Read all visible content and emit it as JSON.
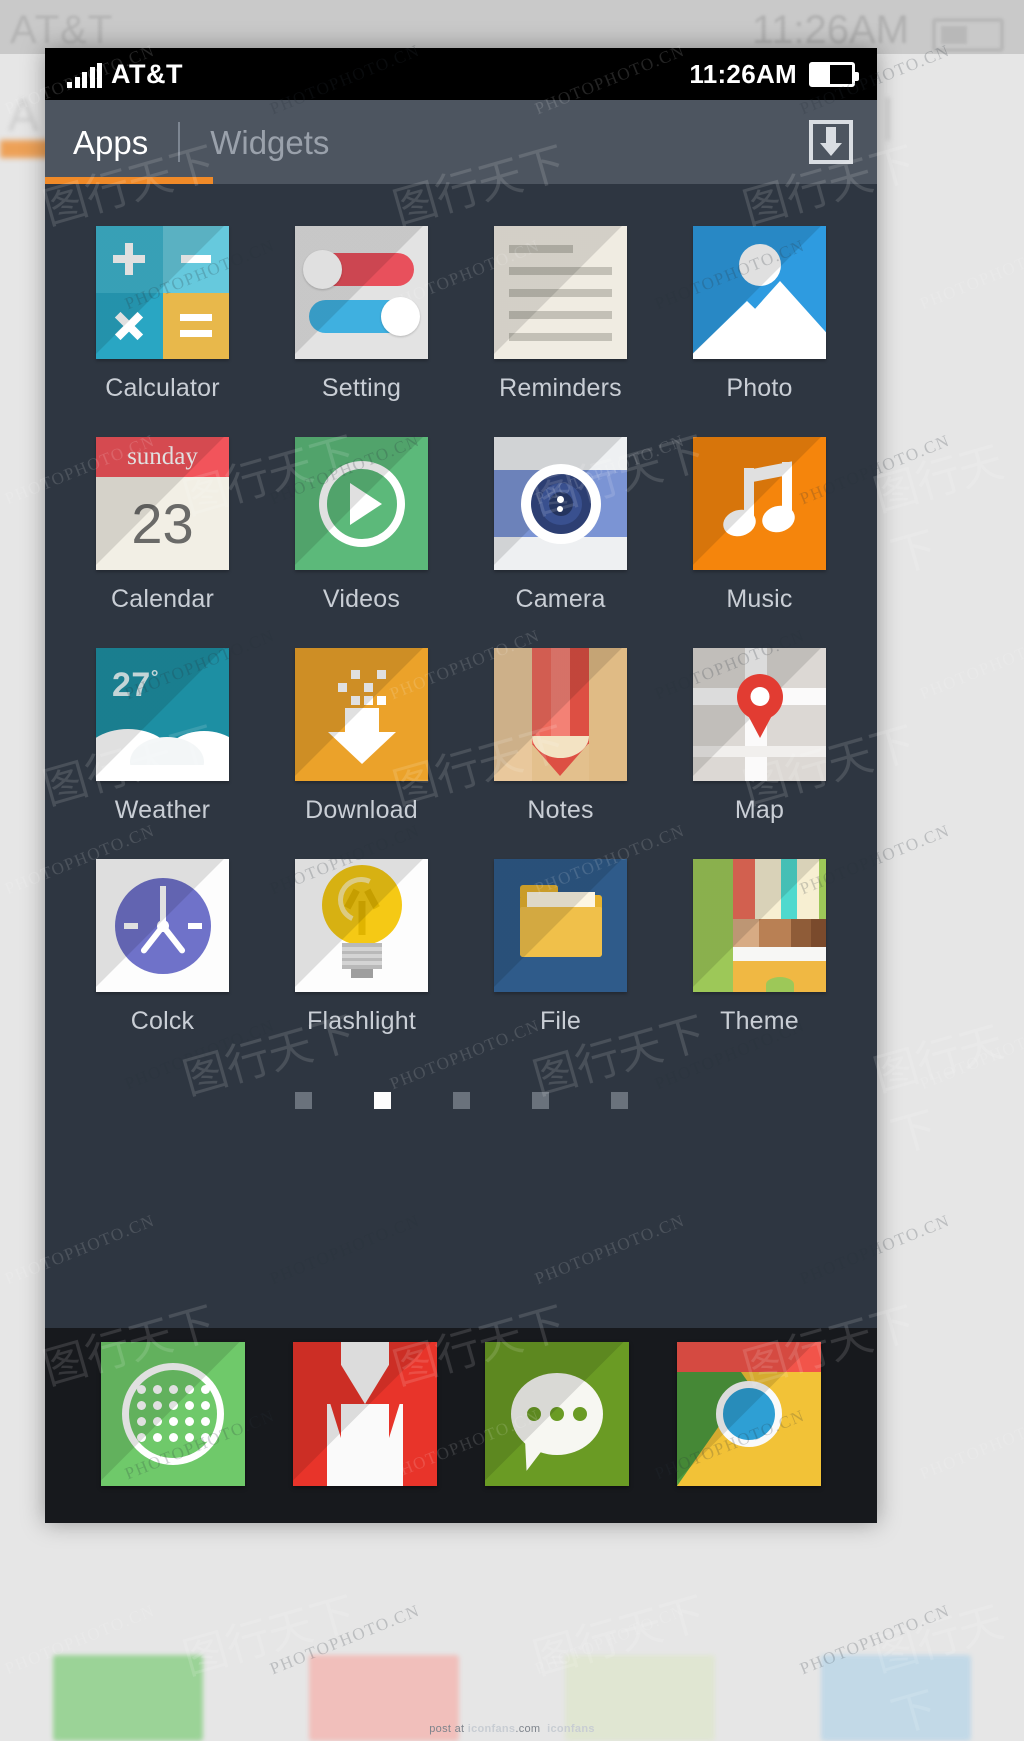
{
  "statusbar": {
    "carrier": "AT&T",
    "time": "11:26AM",
    "signal_icon": "signal-bars-icon",
    "battery_icon": "battery-icon"
  },
  "tabbar": {
    "tabs": [
      {
        "label": "Apps",
        "active": true
      },
      {
        "label": "Widgets",
        "active": false
      }
    ],
    "download_icon": "download-tray-icon",
    "accent_color": "#f08a28"
  },
  "apps": [
    {
      "label": "Calculator",
      "icon": "calculator-icon",
      "keys": [
        "+",
        "−",
        "×",
        "="
      ],
      "colors": [
        "#3fb6cf",
        "#66c9dd",
        "#29a6c3",
        "#e8b84b"
      ]
    },
    {
      "label": "Setting",
      "icon": "settings-toggles-icon",
      "colors": [
        "#e8505c",
        "#3fb0e0",
        "#e3e3e3"
      ]
    },
    {
      "label": "Reminders",
      "icon": "reminders-lines-icon",
      "colors": [
        "#f0ece2",
        "#c3c0b6"
      ]
    },
    {
      "label": "Photo",
      "icon": "photo-mountain-icon",
      "colors": [
        "#2e9be0",
        "#ffffff"
      ]
    },
    {
      "label": "Calendar",
      "icon": "calendar-icon",
      "header_text": "sunday",
      "day_number": "23",
      "colors": [
        "#f2545b",
        "#f2efe5"
      ]
    },
    {
      "label": "Videos",
      "icon": "video-play-icon",
      "colors": [
        "#5cb97a",
        "#ffffff"
      ]
    },
    {
      "label": "Camera",
      "icon": "camera-lens-icon",
      "colors": [
        "#7b94d4",
        "#2d3f73",
        "#eef0f2"
      ]
    },
    {
      "label": "Music",
      "icon": "music-note-icon",
      "colors": [
        "#f5850c",
        "#ffffff"
      ]
    },
    {
      "label": "Weather",
      "icon": "weather-cloud-icon",
      "temperature": "27",
      "degree_symbol": "°",
      "colors": [
        "#1d8fa3",
        "#ffffff"
      ]
    },
    {
      "label": "Download",
      "icon": "download-arrow-icon",
      "colors": [
        "#eba22a",
        "#ffffff"
      ]
    },
    {
      "label": "Notes",
      "icon": "pencil-icon",
      "colors": [
        "#e3c08d",
        "#ef6a5c",
        "#dd4f43"
      ]
    },
    {
      "label": "Map",
      "icon": "map-pin-icon",
      "colors": [
        "#dcd8d4",
        "#e23c32"
      ]
    },
    {
      "label": "Colck",
      "icon": "clock-icon",
      "colors": [
        "#6f72c9",
        "#ffffff"
      ]
    },
    {
      "label": "Flashlight",
      "icon": "lightbulb-icon",
      "colors": [
        "#f5c915",
        "#b9b9b9"
      ]
    },
    {
      "label": "File",
      "icon": "folder-icon",
      "colors": [
        "#2f5b8a",
        "#f0c04a"
      ]
    },
    {
      "label": "Theme",
      "icon": "theme-palette-icon",
      "colors": [
        "#9dc858",
        "#ef6d5a",
        "#4fd9ce",
        "#f0b843"
      ]
    }
  ],
  "pager": {
    "total": 5,
    "active_index": 1
  },
  "dock": [
    {
      "label": "App Drawer",
      "icon": "app-drawer-icon",
      "color": "#6fc96a"
    },
    {
      "label": "Gmail",
      "icon": "gmail-icon",
      "color": "#e8342a"
    },
    {
      "label": "Messages",
      "icon": "messages-bubble-icon",
      "color": "#6a9b24"
    },
    {
      "label": "Chrome",
      "icon": "chrome-icon",
      "color": "#2e9fd4"
    }
  ],
  "credit": {
    "prefix": "post at ",
    "site": "iconfans",
    "suffix": ".com",
    "logo": "iconfans"
  },
  "watermarks": {
    "latin": "PHOTOPHOTO.CN",
    "cn": "图行天下"
  },
  "theme": {
    "screen_bg": "#2e3641",
    "tabbar_bg": "#4d5560",
    "dock_bg": "#17191d",
    "label_color": "#c9ced5"
  }
}
